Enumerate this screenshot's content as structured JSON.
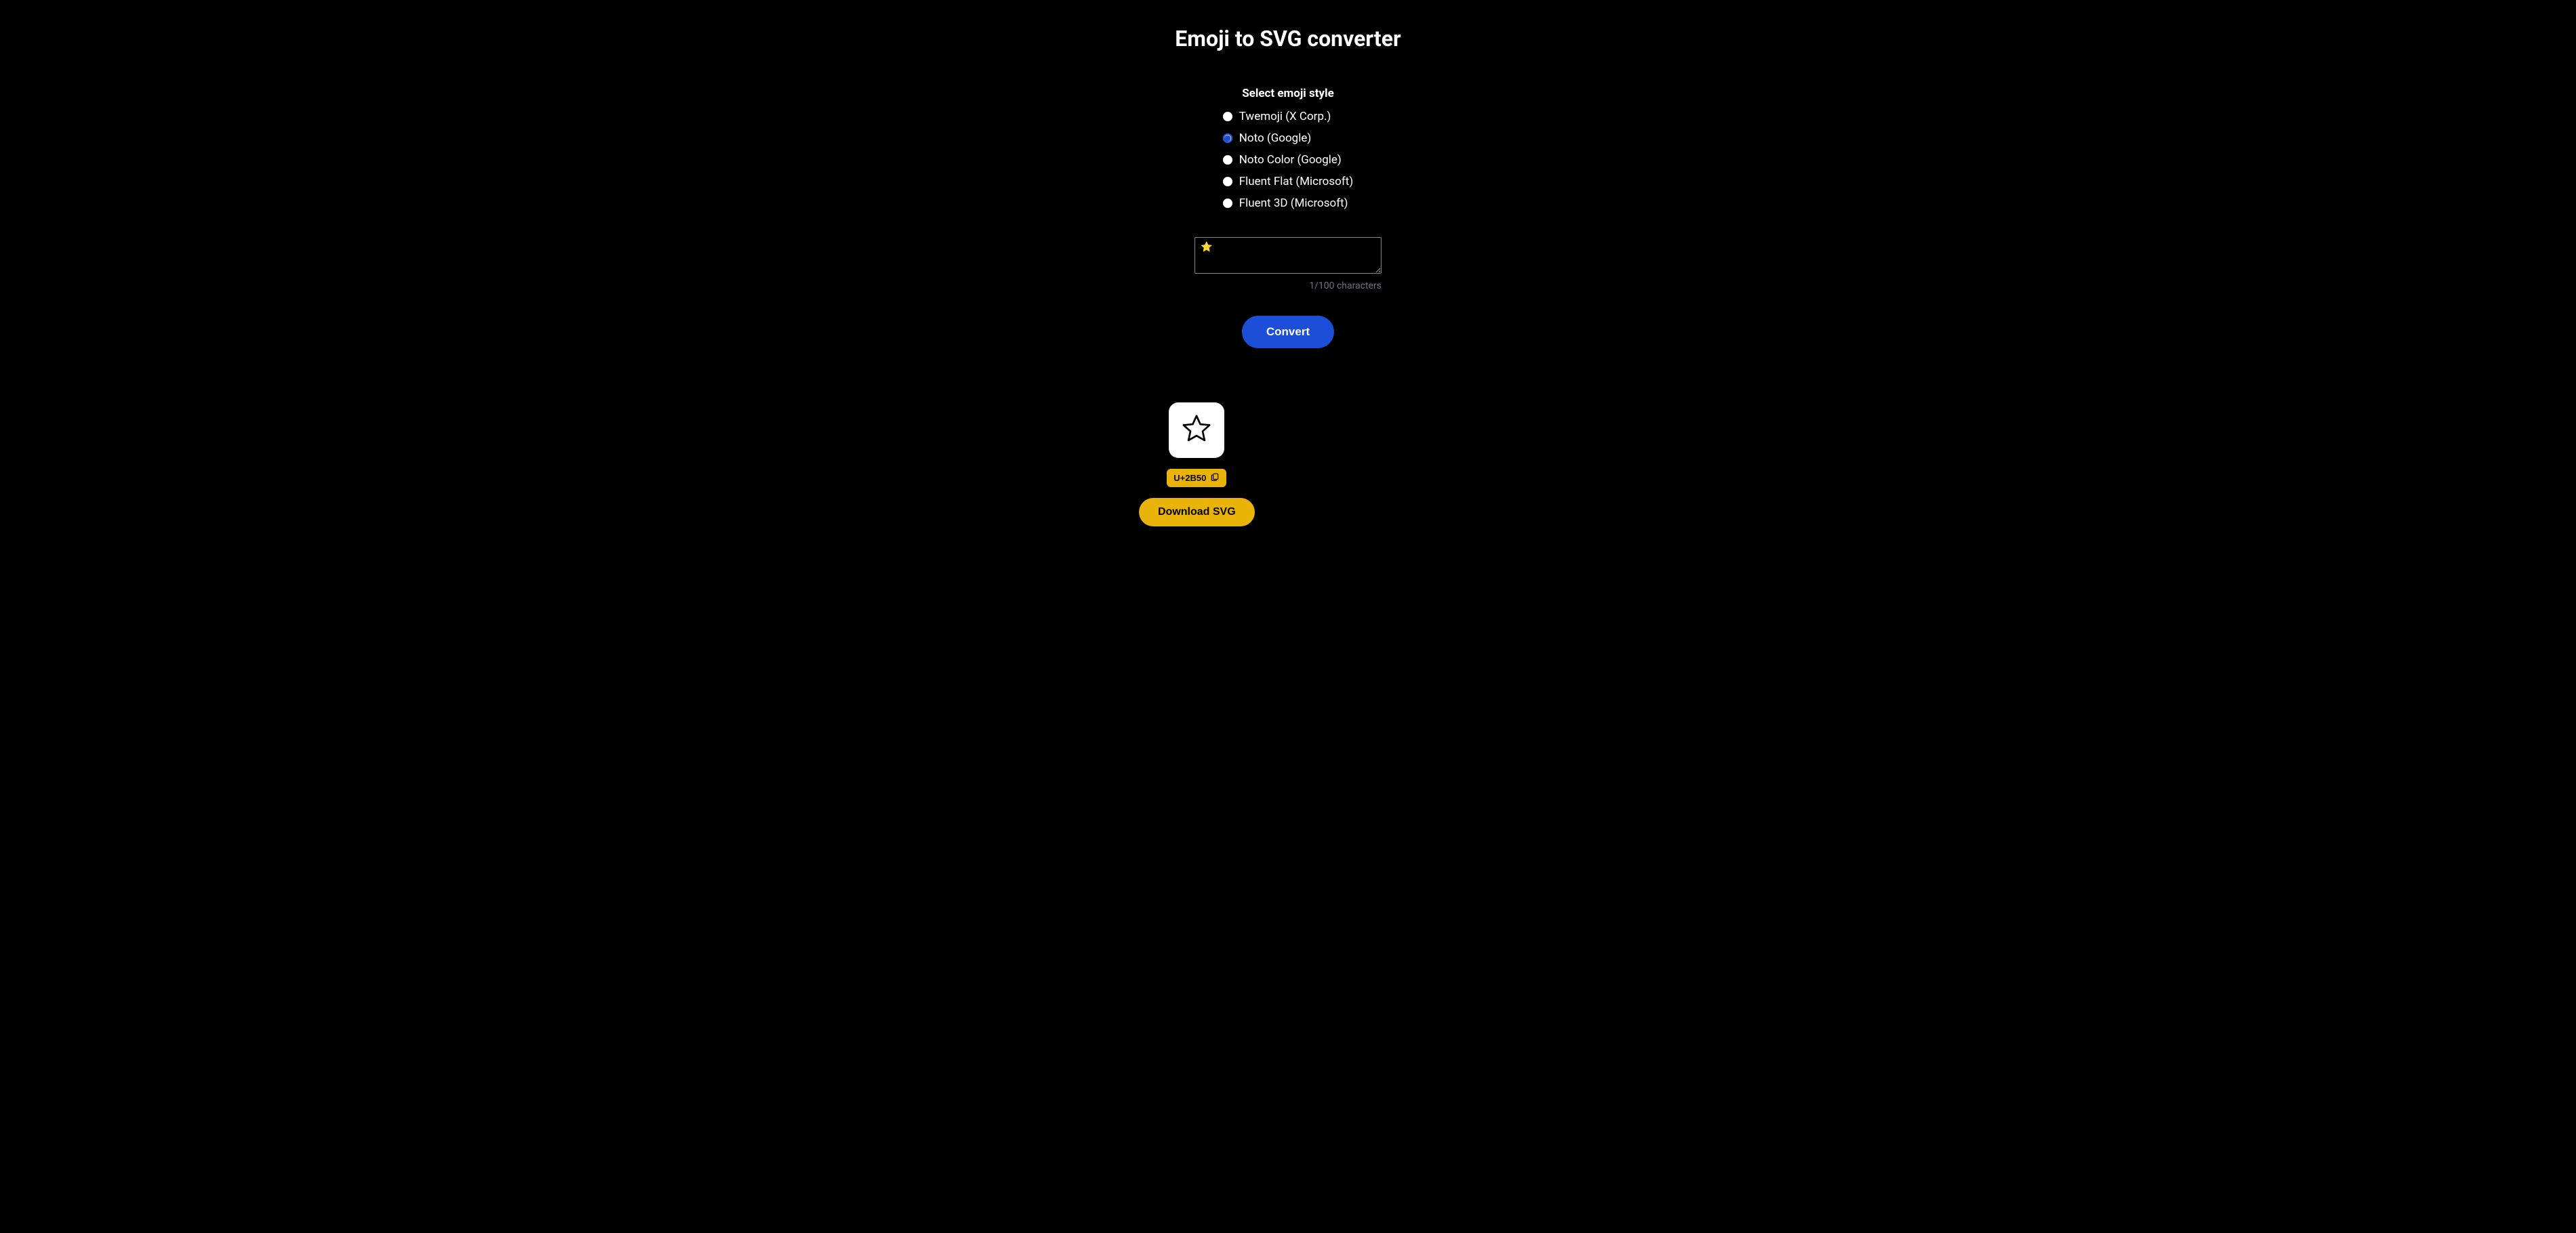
{
  "title": "Emoji to SVG converter",
  "styleSection": {
    "heading": "Select emoji style",
    "options": [
      {
        "id": "twemoji",
        "label": "Twemoji (X Corp.)"
      },
      {
        "id": "noto",
        "label": "Noto (Google)"
      },
      {
        "id": "noto-color",
        "label": "Noto Color (Google)"
      },
      {
        "id": "fluent-flat",
        "label": "Fluent Flat (Microsoft)"
      },
      {
        "id": "fluent-3d",
        "label": "Fluent 3D (Microsoft)"
      }
    ],
    "selected": "noto"
  },
  "input": {
    "value": "⭐",
    "maxLength": 100,
    "counter": "1/100 characters"
  },
  "convertLabel": "Convert",
  "result": {
    "codepoint": "U+2B50",
    "downloadLabel": "Download SVG"
  }
}
